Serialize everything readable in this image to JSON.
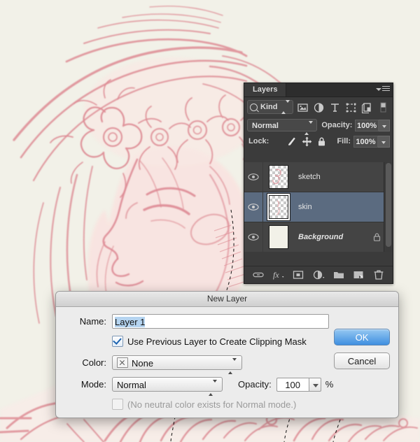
{
  "canvas": {
    "background_color": "#f2f1e8",
    "sketch_color": "#dd8a93",
    "skin_color": "#f7dfdc",
    "artwork_description": "pink pencil sketch of a woman in profile with a flower crown"
  },
  "layers_panel": {
    "tab_label": "Layers",
    "menu_icon": "panel-menu-icon",
    "filter": {
      "kind_label": "Kind",
      "search_icon": "search-icon",
      "icons": [
        "pixel-layer-filter-icon",
        "adjustment-layer-filter-icon",
        "type-layer-filter-icon",
        "shape-layer-filter-icon",
        "smart-object-filter-icon",
        "filter-toggle-icon"
      ]
    },
    "blend_mode": "Normal",
    "opacity_label": "Opacity:",
    "opacity_value": "100%",
    "lock_label": "Lock:",
    "lock_icons": [
      "lock-transparent-pixels-icon",
      "lock-image-pixels-icon",
      "lock-position-icon",
      "lock-all-icon"
    ],
    "fill_label": "Fill:",
    "fill_value": "100%",
    "layers": [
      {
        "name": "sketch",
        "visible": true,
        "selected": false,
        "locked": false,
        "thumb": "transparent",
        "italic": false
      },
      {
        "name": "skin",
        "visible": true,
        "selected": true,
        "locked": false,
        "thumb": "transparent",
        "italic": false
      },
      {
        "name": "Background",
        "visible": true,
        "selected": false,
        "locked": true,
        "thumb": "solid",
        "italic": true
      }
    ],
    "bottom_icons": [
      "link-layers-icon",
      "layer-style-fx-icon",
      "add-layer-mask-icon",
      "new-adjustment-layer-icon",
      "new-group-icon",
      "new-layer-icon",
      "delete-layer-icon"
    ]
  },
  "new_layer_dialog": {
    "title": "New Layer",
    "name_label": "Name:",
    "name_value": "Layer 1",
    "clipping_mask_label": "Use Previous Layer to Create Clipping Mask",
    "clipping_mask_checked": true,
    "color_label": "Color:",
    "color_value": "None",
    "color_swatch_icon": "none-swatch-icon",
    "mode_label": "Mode:",
    "mode_value": "Normal",
    "opacity_label": "Opacity:",
    "opacity_value": "100",
    "percent_symbol": "%",
    "neutral_color_label": "(No neutral color exists for Normal mode.)",
    "neutral_color_checked": false,
    "neutral_color_disabled": true,
    "ok_label": "OK",
    "cancel_label": "Cancel",
    "accent_color": "#3f8fe0"
  }
}
